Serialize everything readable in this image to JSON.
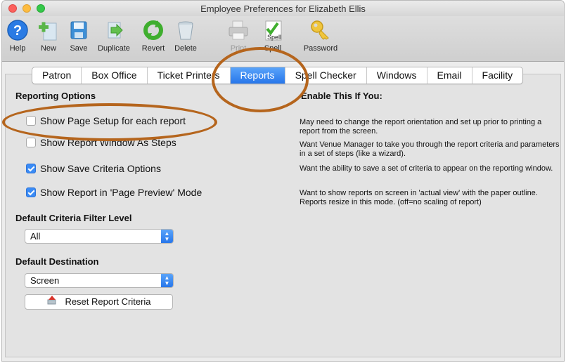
{
  "window": {
    "title": "Employee Preferences for Elizabeth Ellis"
  },
  "toolbar": {
    "help": "Help",
    "new": "New",
    "save": "Save",
    "duplicate": "Duplicate",
    "revert": "Revert",
    "delete": "Delete",
    "print": "Print",
    "spell": "Spell",
    "spell_icon_text": "Spell",
    "password": "Password"
  },
  "tabs": [
    "Patron",
    "Box Office",
    "Ticket Printers",
    "Reports",
    "Spell Checker",
    "Windows",
    "Email",
    "Facility"
  ],
  "active_tab": "Reports",
  "reporting": {
    "header": "Reporting Options",
    "enable_header": "Enable This If You:",
    "options": [
      {
        "label": "Show Page Setup for each report",
        "checked": false,
        "desc": "May need to change the report orientation and set up prior to printing a report from the screen."
      },
      {
        "label": "Show Report Window As Steps",
        "checked": false,
        "desc": "Want Venue Manager to take you through the report criteria and parameters in a set of steps (like a wizard)."
      },
      {
        "label": "Show Save Criteria Options",
        "checked": true,
        "desc": "Want the ability to save a set of criteria to appear on the reporting window."
      },
      {
        "label": "Show Report in 'Page Preview' Mode",
        "checked": true,
        "desc": "Want to show reports on screen in 'actual view' with the paper outline.  Reports resize in this mode.  (off=no scaling of report)"
      }
    ]
  },
  "filter": {
    "header": "Default Criteria Filter Level",
    "value": "All"
  },
  "destination": {
    "header": "Default Destination",
    "value": "Screen"
  },
  "reset_button": "Reset Report Criteria",
  "colors": {
    "accent": "#2f80ed",
    "annotation": "#b5651d"
  }
}
